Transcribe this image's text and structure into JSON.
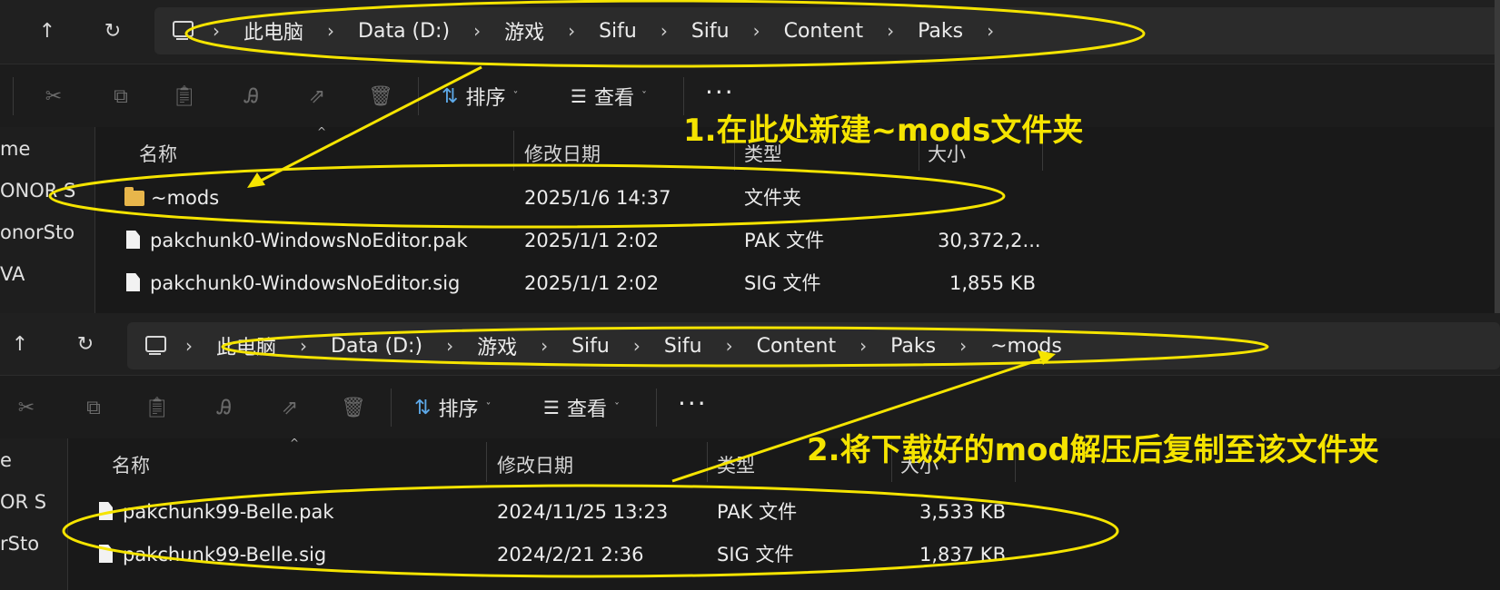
{
  "window1": {
    "breadcrumbs": [
      "此电脑",
      "Data (D:)",
      "游戏",
      "Sifu",
      "Sifu",
      "Content",
      "Paks"
    ],
    "toolbar": {
      "sort_label": "排序",
      "view_label": "查看",
      "more_label": "···"
    },
    "sidebar_items": [
      "me",
      "ONOR S",
      "onorSto",
      "VA"
    ],
    "columns": {
      "name": "名称",
      "date": "修改日期",
      "type": "类型",
      "size": "大小"
    },
    "files": [
      {
        "name": "~mods",
        "date": "2025/1/6 14:37",
        "type": "文件夹",
        "size": "",
        "icon": "folder-icon"
      },
      {
        "name": "pakchunk0-WindowsNoEditor.pak",
        "date": "2025/1/1 2:02",
        "type": "PAK 文件",
        "size": "30,372,2...",
        "icon": "file-icon"
      },
      {
        "name": "pakchunk0-WindowsNoEditor.sig",
        "date": "2025/1/1 2:02",
        "type": "SIG 文件",
        "size": "1,855 KB",
        "icon": "file-icon"
      }
    ]
  },
  "window2": {
    "breadcrumbs": [
      "此电脑",
      "Data (D:)",
      "游戏",
      "Sifu",
      "Sifu",
      "Content",
      "Paks",
      "~mods"
    ],
    "toolbar": {
      "sort_label": "排序",
      "view_label": "查看",
      "more_label": "···"
    },
    "sidebar_items": [
      "e",
      "OR S",
      "rSto"
    ],
    "columns": {
      "name": "名称",
      "date": "修改日期",
      "type": "类型",
      "size": "大小"
    },
    "files": [
      {
        "name": "pakchunk99-Belle.pak",
        "date": "2024/11/25 13:23",
        "type": "PAK 文件",
        "size": "3,533 KB",
        "icon": "file-icon"
      },
      {
        "name": "pakchunk99-Belle.sig",
        "date": "2024/2/21 2:36",
        "type": "SIG 文件",
        "size": "1,837 KB",
        "icon": "file-icon"
      }
    ]
  },
  "annotations": {
    "step1": "1.在此处新建~mods文件夹",
    "step2": "2.将下载好的mod解压后复制至该文件夹"
  },
  "colors": {
    "annotation": "#f5e400",
    "folder": "#e8b64b",
    "accent": "#5da9e9",
    "background": "#191919"
  },
  "icons": {
    "up": "arrow-up-icon",
    "refresh": "refresh-icon",
    "computer": "computer-icon",
    "cut": "cut-icon",
    "copy": "copy-icon",
    "paste": "paste-icon",
    "rename": "rename-icon",
    "share": "share-icon",
    "delete": "delete-icon",
    "sort": "sort-icon",
    "view": "view-icon"
  }
}
